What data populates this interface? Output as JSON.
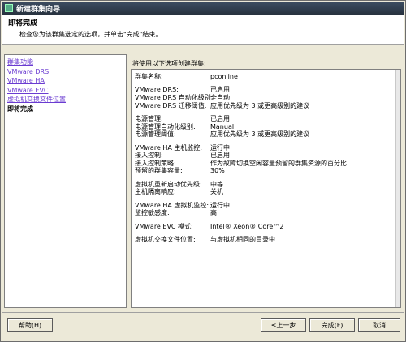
{
  "window": {
    "title": "新建群集向导"
  },
  "header": {
    "title": "即将完成",
    "description": "检查您为该群集选定的选项，并单击\"完成\"结束。"
  },
  "nav": {
    "items": [
      {
        "label": "群集功能",
        "current": false
      },
      {
        "label": "VMware DRS",
        "current": false
      },
      {
        "label": "VMware HA",
        "current": false
      },
      {
        "label": "VMware EVC",
        "current": false
      },
      {
        "label": "虚拟机交换文件位置",
        "current": false
      },
      {
        "label": "即将完成",
        "current": true
      }
    ]
  },
  "summary": {
    "label": "将使用以下选项创建群集:",
    "groups": [
      [
        {
          "k": "群集名称:",
          "v": "pconline"
        }
      ],
      [
        {
          "k": "VMware DRS:",
          "v": "已启用"
        },
        {
          "k": "VMware DRS 自动化级别:",
          "v": "全自动"
        },
        {
          "k": "VMware DRS 迁移阈值:",
          "v": "应用优先级为 3 或更高级别的建议"
        }
      ],
      [
        {
          "k": "电源管理:",
          "v": "已启用"
        },
        {
          "k": "电源管理自动化级别:",
          "v": "Manual"
        },
        {
          "k": "电源管理阈值:",
          "v": "应用优先级为 3 或更高级别的建议"
        }
      ],
      [
        {
          "k": "VMware HA 主机监控:",
          "v": "运行中"
        },
        {
          "k": "接入控制:",
          "v": "已启用"
        },
        {
          "k": "接入控制策略:",
          "v": "作为故障切换空闲容量预留的群集资源的百分比"
        },
        {
          "k": "预留的群集容量:",
          "v": "30%"
        }
      ],
      [
        {
          "k": "虚拟机重新启动优先级:",
          "v": "中等"
        },
        {
          "k": "主机隔离响应:",
          "v": "关机"
        }
      ],
      [
        {
          "k": "VMware HA 虚拟机监控:",
          "v": "运行中"
        },
        {
          "k": "监控敏感度:",
          "v": "高"
        }
      ],
      [
        {
          "k": "VMware EVC 模式:",
          "v": "Intel® Xeon® Core™2"
        }
      ],
      [
        {
          "k": "虚拟机交换文件位置:",
          "v": "与虚拟机相同的目录中"
        }
      ]
    ]
  },
  "buttons": {
    "help": "帮助(H)",
    "back": "≤上一步",
    "finish": "完成(F)",
    "cancel": "取消"
  }
}
